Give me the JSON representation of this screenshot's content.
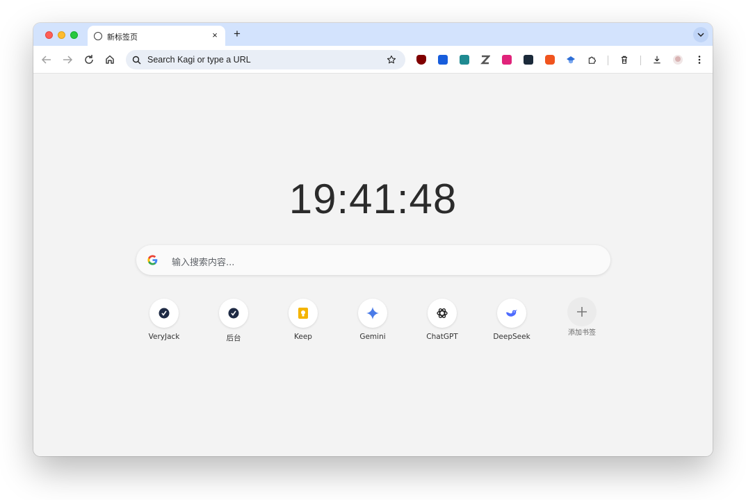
{
  "tab": {
    "title": "新标签页",
    "close": "×"
  },
  "new_tab_glyph": "+",
  "omnibox": {
    "placeholder": "Search Kagi or type a URL"
  },
  "extensions": [
    {
      "icon": "ublock-icon",
      "color": "#800000"
    },
    {
      "icon": "bitwarden-icon",
      "color": "#175ddc"
    },
    {
      "icon": "vocabulary-icon",
      "color": "#1f8a91"
    },
    {
      "icon": "zotero-icon",
      "color": "#555555"
    },
    {
      "icon": "translate-icon",
      "color": "#e0237a"
    },
    {
      "icon": "lightning-icon",
      "color": "#1b2a3a"
    },
    {
      "icon": "rss-icon",
      "color": "#f0541e"
    },
    {
      "icon": "graduation-icon",
      "color": "#2f6fd6"
    }
  ],
  "clock": {
    "time": "19:41:48"
  },
  "search": {
    "placeholder": "输入搜索内容..."
  },
  "shortcuts": [
    {
      "label": "VeryJack",
      "icon": "veryjack-icon"
    },
    {
      "label": "后台",
      "icon": "veryjack-icon"
    },
    {
      "label": "Keep",
      "icon": "keep-icon"
    },
    {
      "label": "Gemini",
      "icon": "gemini-icon"
    },
    {
      "label": "ChatGPT",
      "icon": "chatgpt-icon"
    },
    {
      "label": "DeepSeek",
      "icon": "deepseek-icon"
    }
  ],
  "add_shortcut": {
    "label": "添加书签",
    "glyph": "+"
  },
  "colors": {
    "tab_strip": "#d3e3fd",
    "page_bg": "#f3f3f3",
    "omnibox_bg": "#e9eef6"
  }
}
